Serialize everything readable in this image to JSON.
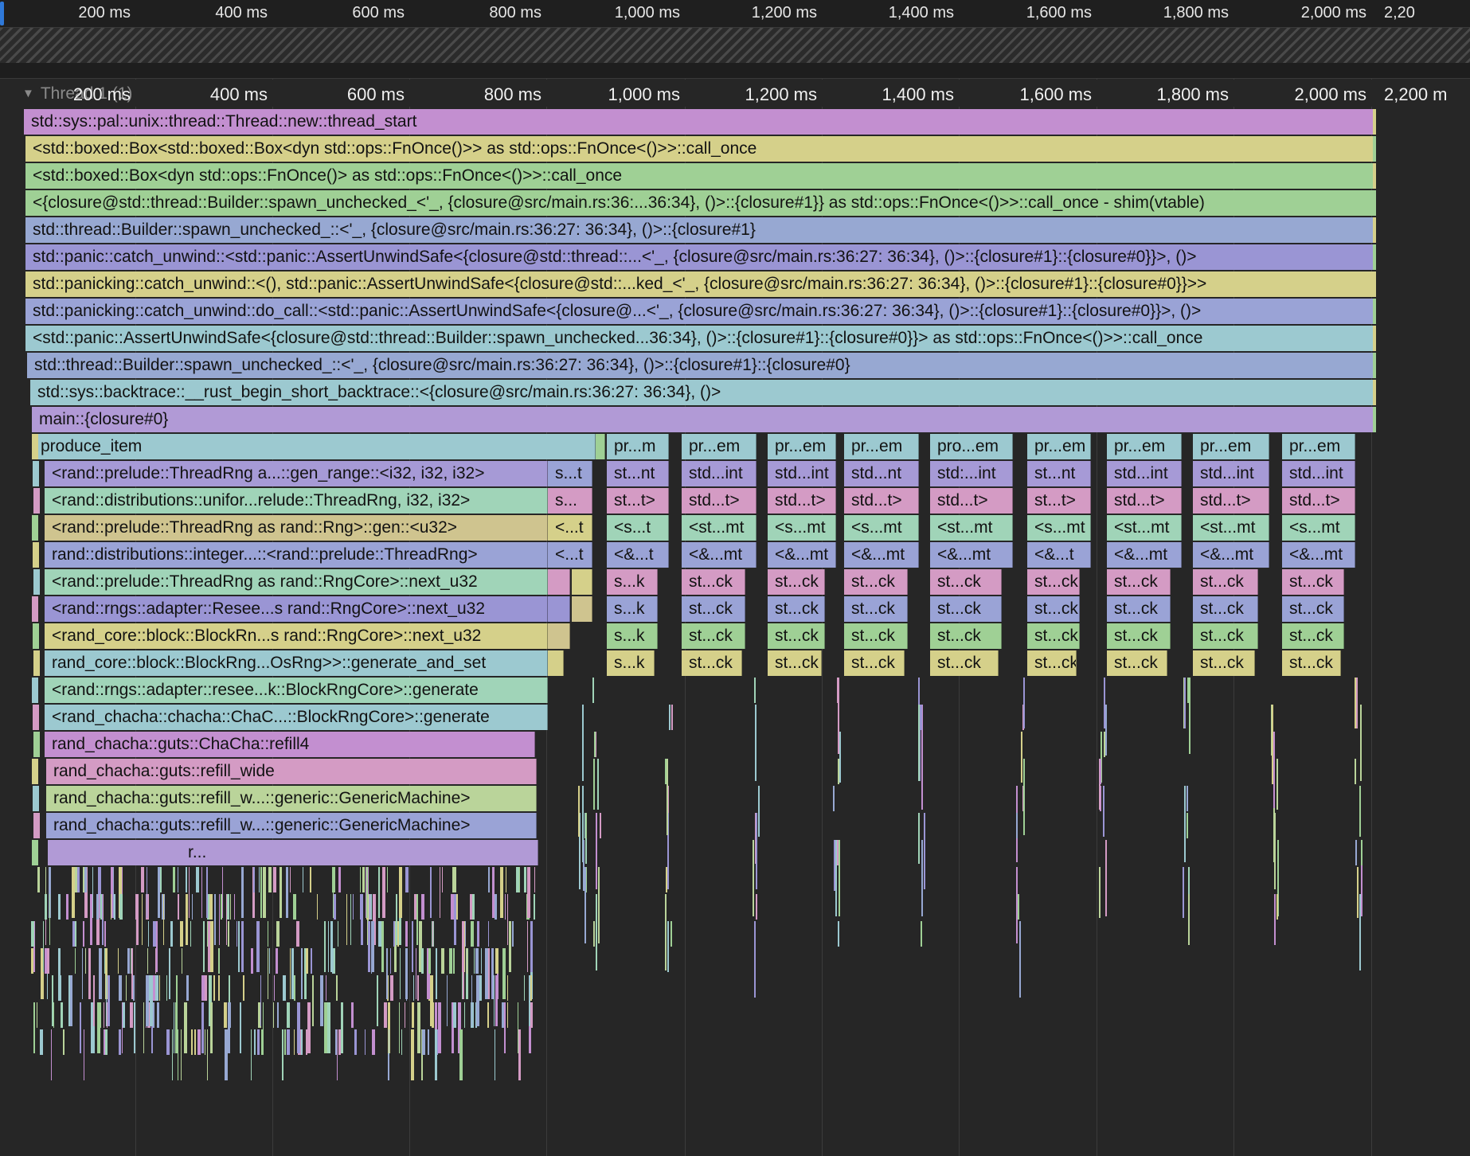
{
  "timeline": {
    "ticks_top": [
      "200 ms",
      "400 ms",
      "600 ms",
      "800 ms",
      "1,000 ms",
      "1,200 ms",
      "1,400 ms",
      "1,600 ms",
      "1,800 ms",
      "2,000 ms",
      "2,20"
    ],
    "ticks_mid": [
      "200 ms",
      "400 ms",
      "600 ms",
      "800 ms",
      "1,000 ms",
      "1,200 ms",
      "1,400 ms",
      "1,600 ms",
      "1,800 ms",
      "2,000 ms",
      "2,200 m"
    ]
  },
  "thread": {
    "label": "Thread 1 (1)",
    "expanded": true
  },
  "colors": {
    "purple": "#c38fd0",
    "khaki": "#d5d08a",
    "green": "#9fd095",
    "blue": "#97a8d2",
    "violet": "#9a95d4",
    "teal": "#9cc9d0",
    "lavender": "#b19ad6",
    "rose": "#d293b8",
    "mint": "#a0d4b8",
    "tan": "#cfc48f",
    "slate": "#9aa3d6",
    "lilac": "#a69ad6",
    "pink": "#d49bc4",
    "lime": "#bad49a"
  },
  "stack": [
    "std::sys::pal::unix::thread::Thread::new::thread_start",
    "<std::boxed::Box<std::boxed::Box<dyn std::ops::FnOnce()>> as std::ops::FnOnce<()>>::call_once",
    "<std::boxed::Box<dyn std::ops::FnOnce()> as std::ops::FnOnce<()>>::call_once",
    "<{closure@std::thread::Builder::spawn_unchecked_<'_, {closure@src/main.rs:36:...36:34}, ()>::{closure#1}} as std::ops::FnOnce<()>>::call_once - shim(vtable)",
    "std::thread::Builder::spawn_unchecked_::<'_, {closure@src/main.rs:36:27: 36:34}, ()>::{closure#1}",
    "std::panic::catch_unwind::<std::panic::AssertUnwindSafe<{closure@std::thread::...<'_, {closure@src/main.rs:36:27: 36:34}, ()>::{closure#1}::{closure#0}}>, ()>",
    "std::panicking::catch_unwind::<(), std::panic::AssertUnwindSafe<{closure@std::...ked_<'_, {closure@src/main.rs:36:27: 36:34}, ()>::{closure#1}::{closure#0}}>>",
    "std::panicking::catch_unwind::do_call::<std::panic::AssertUnwindSafe<{closure@...<'_, {closure@src/main.rs:36:27: 36:34}, ()>::{closure#1}::{closure#0}}>, ()>",
    "<std::panic::AssertUnwindSafe<{closure@std::thread::Builder::spawn_unchecked...36:34}, ()>::{closure#1}::{closure#0}}> as std::ops::FnOnce<()>>::call_once",
    "std::thread::Builder::spawn_unchecked_::<'_, {closure@src/main.rs:36:27: 36:34}, ()>::{closure#1}::{closure#0}",
    "std::sys::backtrace::__rust_begin_short_backtrace::<{closure@src/main.rs:36:27: 36:34}, ()>",
    "main::{closure#0}"
  ],
  "main_column": [
    "produce_item",
    "<rand::prelude::ThreadRng a...::gen_range::<i32, i32, i32>",
    "<rand::distributions::unifor...relude::ThreadRng, i32, i32>",
    "<rand::prelude::ThreadRng as rand::Rng>::gen::<u32>",
    "rand::distributions::integer...::<rand::prelude::ThreadRng>",
    "<rand::prelude::ThreadRng as rand::RngCore>::next_u32",
    "<rand::rngs::adapter::Resee...s rand::RngCore>::next_u32",
    "<rand_core::block::BlockRn...s rand::RngCore>::next_u32",
    "rand_core::block::BlockRng...OsRng>>::generate_and_set",
    "<rand::rngs::adapter::resee...k::BlockRngCore>::generate",
    "<rand_chacha::chacha::ChaC...::BlockRngCore>::generate",
    "rand_chacha::guts::ChaCha::refill4",
    "rand_chacha::guts::refill_wide",
    "rand_chacha::guts::refill_w...::generic::GenericMachine>",
    "rand_chacha::guts::refill_w...::generic::GenericMachine>",
    "r..."
  ],
  "narrow_column": [
    "s...t",
    "s...",
    "<...t",
    "<...t"
  ],
  "repeat_columns": [
    [
      "pr...m",
      "st...nt",
      "st...t>",
      "<s...t",
      "<&...t",
      "s...k",
      "s...k",
      "s...k",
      "s...k"
    ],
    [
      "pr...em",
      "std...int",
      "std...t>",
      "<st...mt",
      "<&...mt",
      "st...ck",
      "st...ck",
      "st...ck",
      "st...ck"
    ],
    [
      "pr...em",
      "std...int",
      "std...t>",
      "<s...mt",
      "<&...mt",
      "st...ck",
      "st...ck",
      "st...ck",
      "st...ck"
    ],
    [
      "pr...em",
      "std...nt",
      "std...t>",
      "<s...mt",
      "<&...mt",
      "st...ck",
      "st...ck",
      "st...ck",
      "st...ck"
    ],
    [
      "pro...em",
      "std:...int",
      "std...t>",
      "<st...mt",
      "<&...mt",
      "st...ck",
      "st...ck",
      "st...ck",
      "st...ck"
    ],
    [
      "pr...em",
      "st...nt",
      "st...t>",
      "<s...mt",
      "<&...t",
      "st...ck",
      "st...ck",
      "st...ck",
      "st...ck"
    ],
    [
      "pr...em",
      "std...int",
      "std...t>",
      "<st...mt",
      "<&...mt",
      "st...ck",
      "st...ck",
      "st...ck",
      "st...ck"
    ],
    [
      "pr...em",
      "std...int",
      "std...t>",
      "<st...mt",
      "<&...mt",
      "st...ck",
      "st...ck",
      "st...ck",
      "st...ck"
    ],
    [
      "pr...em",
      "std...int",
      "std...t>",
      "<s...mt",
      "<&...mt",
      "st...ck",
      "st...ck",
      "st...ck",
      "st...ck"
    ]
  ]
}
